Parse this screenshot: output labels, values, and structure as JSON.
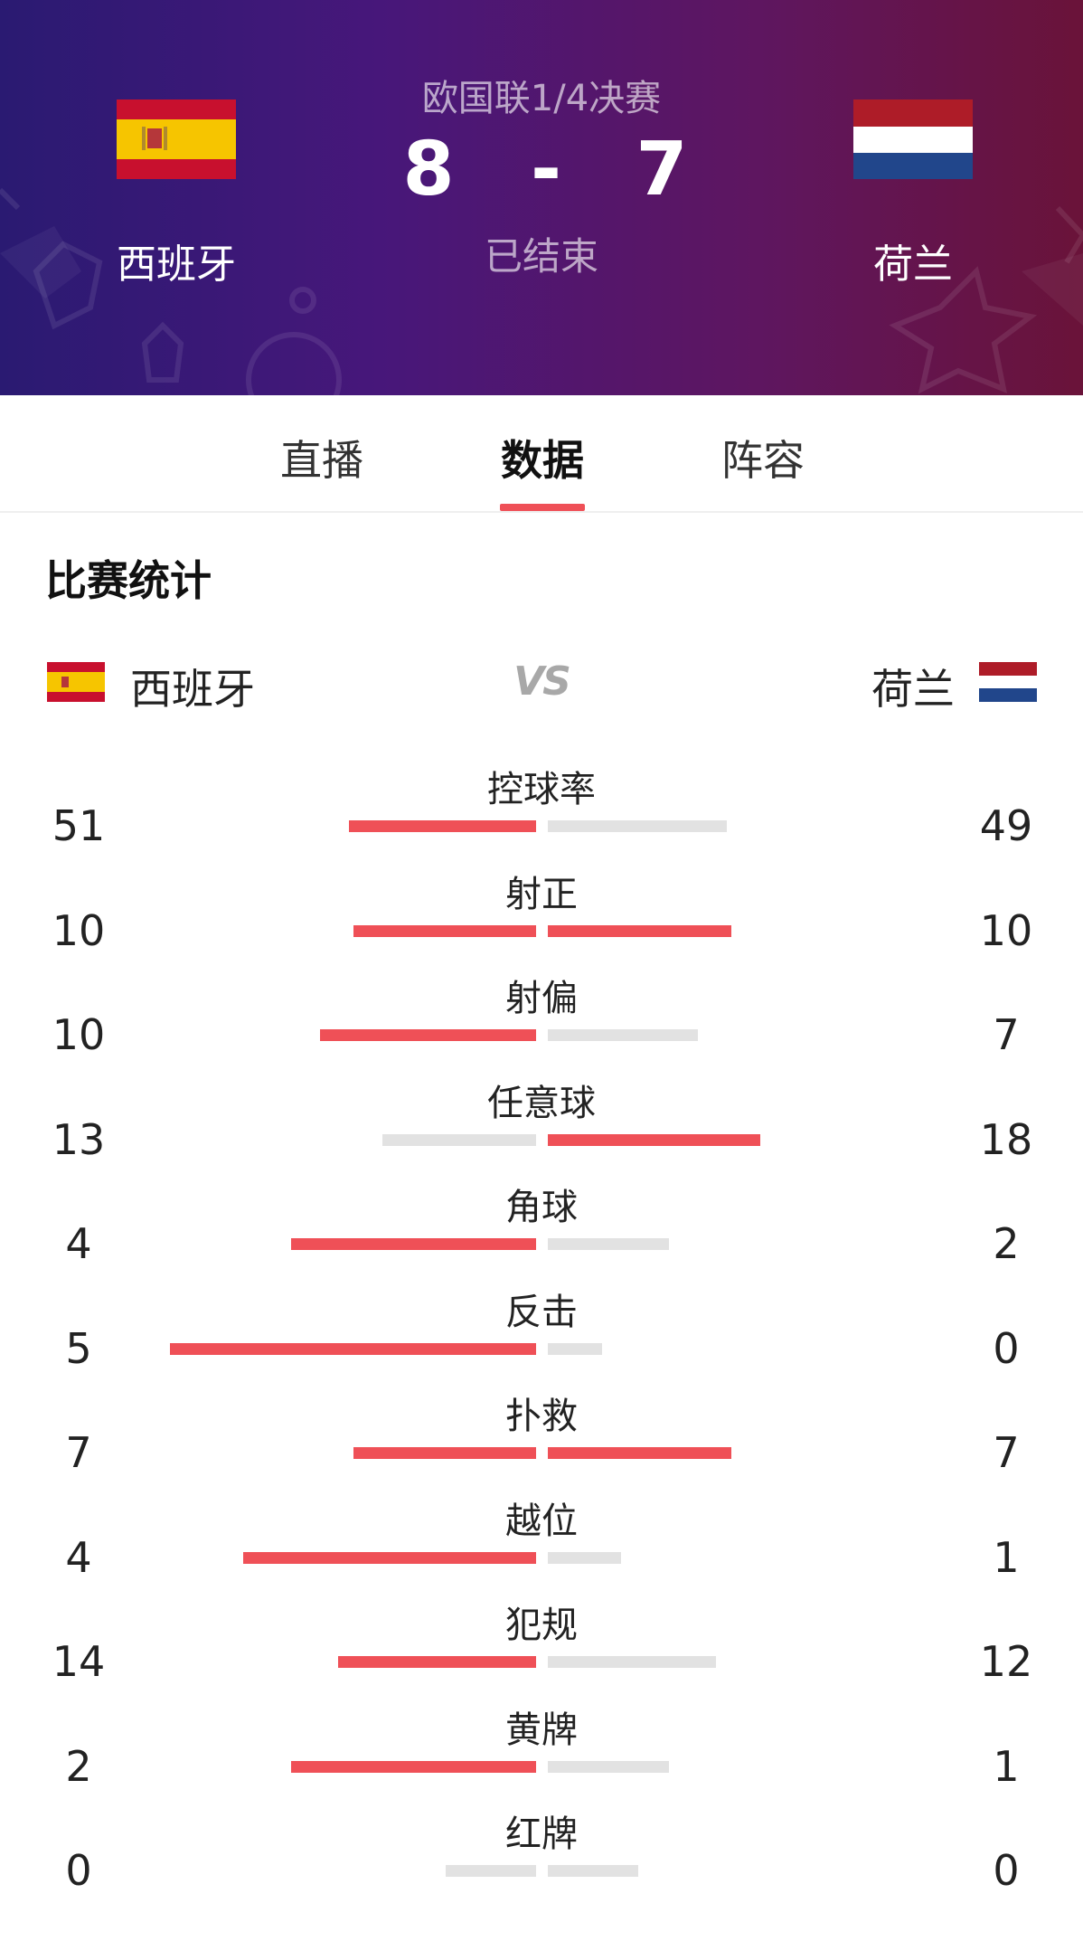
{
  "match": {
    "competition": "欧国联1/4决赛",
    "home_score": "8",
    "separator": "-",
    "away_score": "7",
    "status": "已结束",
    "home_team": "西班牙",
    "away_team": "荷兰"
  },
  "tabs": [
    {
      "label": "直播",
      "active": false
    },
    {
      "label": "数据",
      "active": true
    },
    {
      "label": "阵容",
      "active": false
    }
  ],
  "section": {
    "title": "比赛统计",
    "home_team": "西班牙",
    "vs": "VS",
    "away_team": "荷兰"
  },
  "colors": {
    "accent": "#ef5057",
    "bar_inactive": "#e2e2e2",
    "header_gradient_start": "#2a1a72",
    "header_gradient_end": "#6a1339"
  },
  "stats": [
    {
      "label": "控球率",
      "home": "51",
      "away": "49",
      "home_fraction": 0.51,
      "away_fraction": 0.49
    },
    {
      "label": "射正",
      "home": "10",
      "away": "10",
      "home_fraction": 0.5,
      "away_fraction": 0.5
    },
    {
      "label": "射偏",
      "home": "10",
      "away": "7",
      "home_fraction": 0.59,
      "away_fraction": 0.41
    },
    {
      "label": "任意球",
      "home": "13",
      "away": "18",
      "home_fraction": 0.42,
      "away_fraction": 0.58
    },
    {
      "label": "角球",
      "home": "4",
      "away": "2",
      "home_fraction": 0.67,
      "away_fraction": 0.33
    },
    {
      "label": "反击",
      "home": "5",
      "away": "0",
      "home_fraction": 1.0,
      "away_fraction": 0.0
    },
    {
      "label": "扑救",
      "home": "7",
      "away": "7",
      "home_fraction": 0.5,
      "away_fraction": 0.5
    },
    {
      "label": "越位",
      "home": "4",
      "away": "1",
      "home_fraction": 0.8,
      "away_fraction": 0.2
    },
    {
      "label": "犯规",
      "home": "14",
      "away": "12",
      "home_fraction": 0.54,
      "away_fraction": 0.46
    },
    {
      "label": "黄牌",
      "home": "2",
      "away": "1",
      "home_fraction": 0.67,
      "away_fraction": 0.33
    },
    {
      "label": "红牌",
      "home": "0",
      "away": "0",
      "home_fraction": 0.0,
      "away_fraction": 0.0
    }
  ]
}
